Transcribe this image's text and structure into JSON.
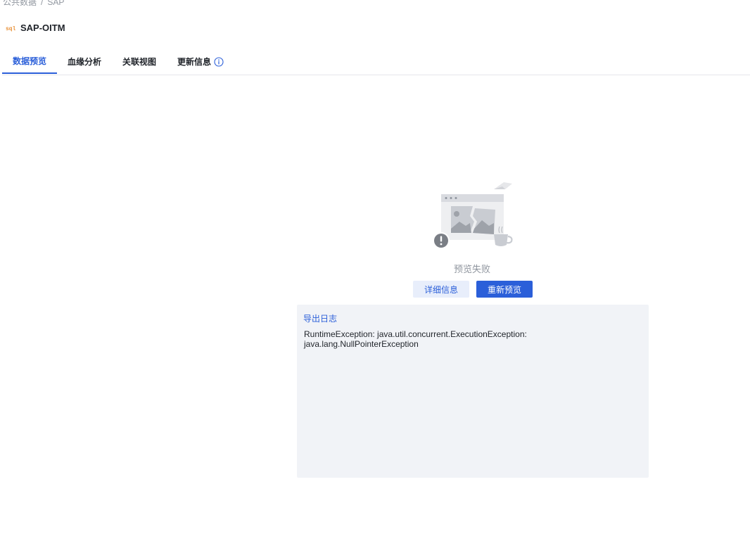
{
  "breadcrumb": {
    "items": [
      "公共数据",
      "SAP"
    ],
    "separator": "/"
  },
  "header": {
    "icon": "sql-icon",
    "title": "SAP-OITM"
  },
  "tabs": [
    {
      "label": "数据预览",
      "active": true
    },
    {
      "label": "血缘分析",
      "active": false
    },
    {
      "label": "关联视图",
      "active": false
    },
    {
      "label": "更新信息",
      "active": false,
      "icon": "info-icon"
    }
  ],
  "preview": {
    "illustration": "broken-image-with-coffee-cup",
    "status": "预览失败",
    "detail_button": "详细信息",
    "retry_button": "重新预览"
  },
  "log": {
    "export_label": "导出日志",
    "lines": [
      "RuntimeException: java.util.concurrent.ExecutionException:",
      "java.lang.NullPointerException"
    ]
  },
  "colors": {
    "accent": "#2b5fd9",
    "panel_bg": "#f1f3f7",
    "muted_text": "#8f959e"
  }
}
